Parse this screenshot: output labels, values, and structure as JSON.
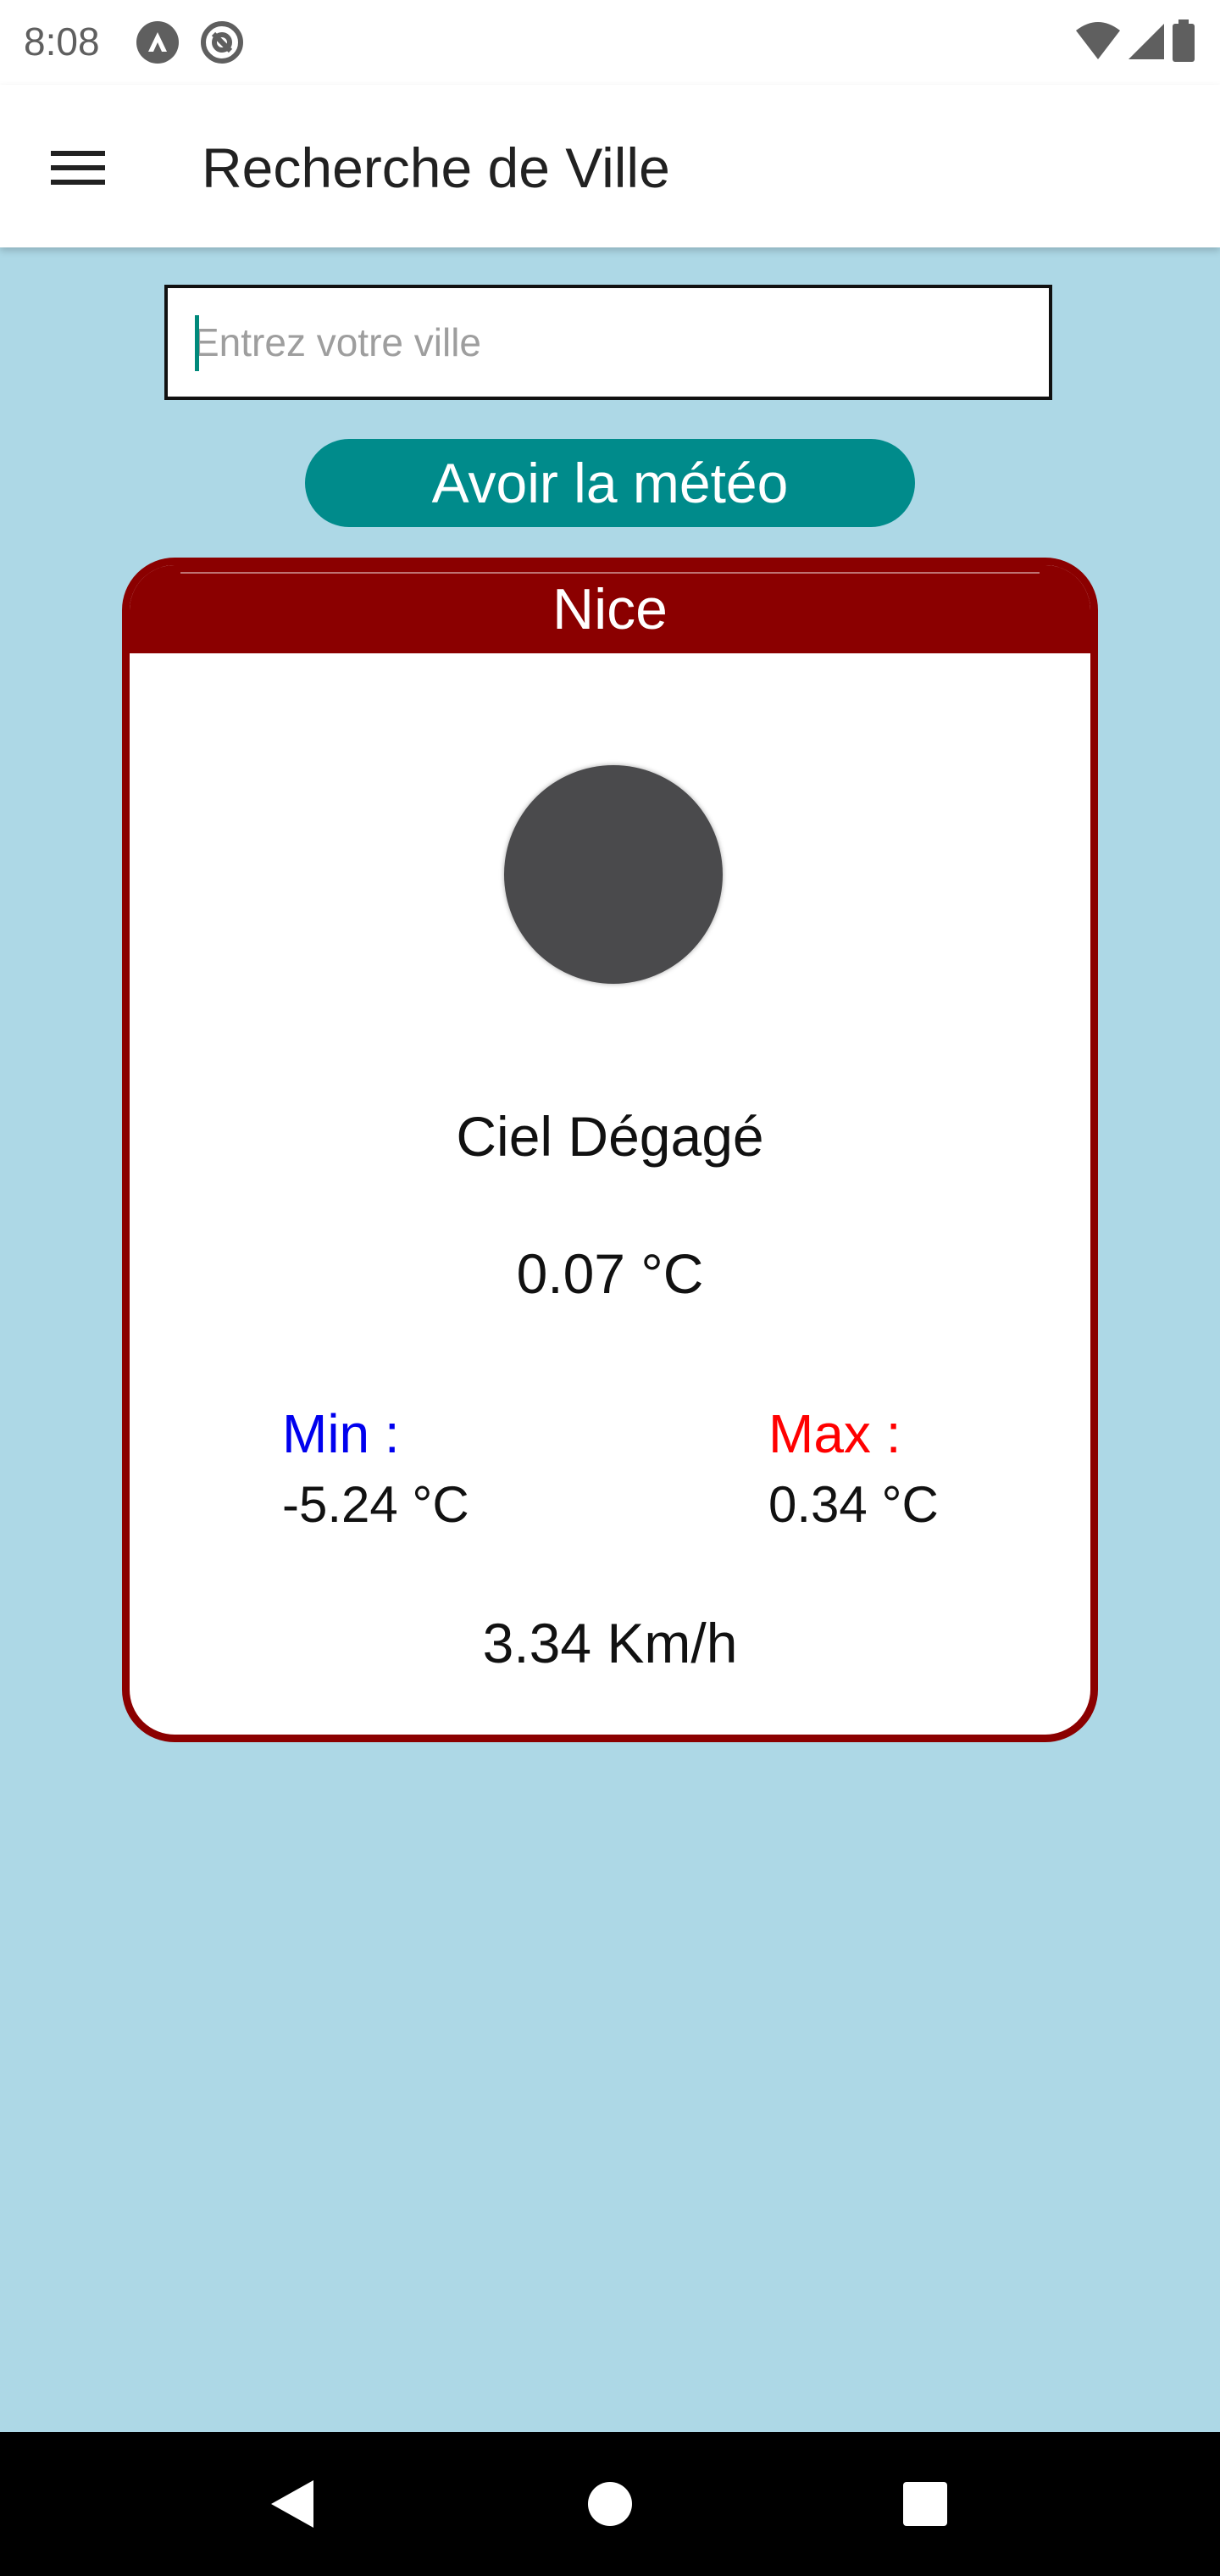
{
  "status_bar": {
    "time": "8:08",
    "icons_left": [
      "app-a-icon",
      "at-sign-icon"
    ],
    "icons_right": [
      "wifi-icon",
      "cellular-signal-icon",
      "battery-icon"
    ]
  },
  "app_bar": {
    "menu_icon": "hamburger-menu-icon",
    "title": "Recherche de Ville"
  },
  "search": {
    "placeholder": "Entrez votre ville",
    "value": ""
  },
  "submit_button": {
    "label": "Avoir la météo",
    "color": "#008b8b"
  },
  "weather_card": {
    "city": "Nice",
    "accent_color": "#8b0000",
    "icon": "clear-sky-icon",
    "description": "Ciel Dégagé",
    "temperature": "0.07 °C",
    "min_label": "Min :",
    "min_value": "-5.24 °C",
    "max_label": "Max :",
    "max_value": "0.34 °C",
    "wind_speed": "3.34 Km/h"
  },
  "colors": {
    "background": "#add8e6",
    "min_label": "#0000ee",
    "max_label": "#ff0000"
  },
  "nav_bar": {
    "buttons": [
      "back-icon",
      "home-icon",
      "recents-icon"
    ]
  }
}
